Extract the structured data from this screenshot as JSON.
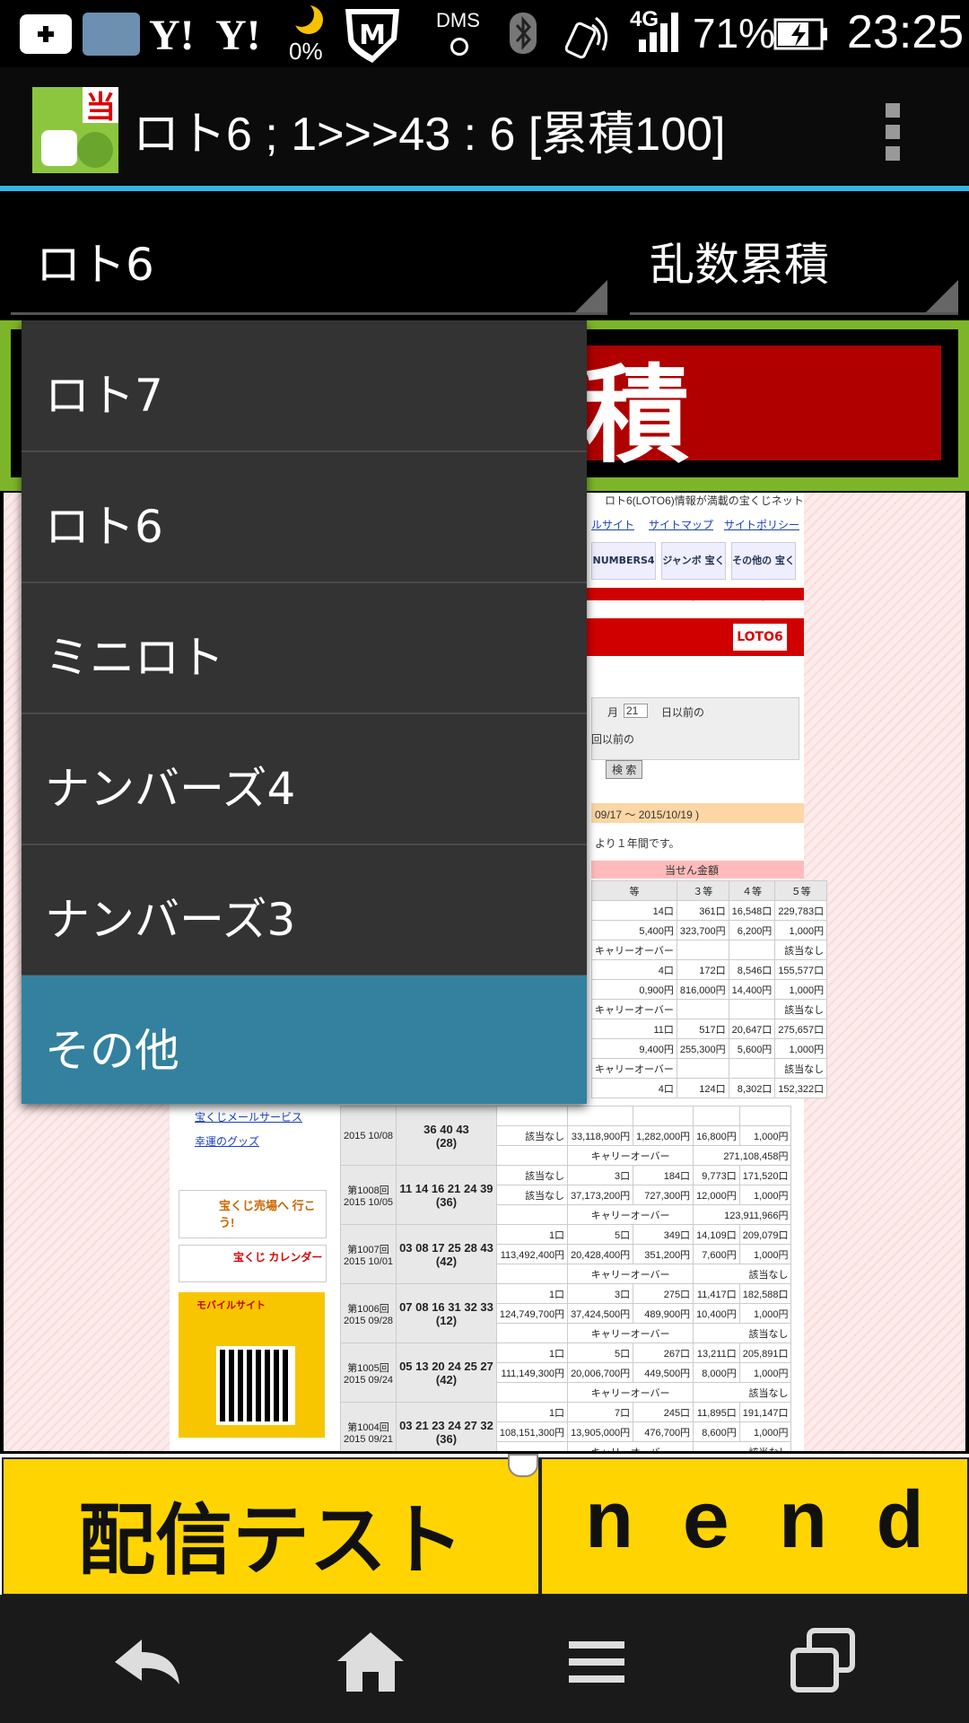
{
  "status_bar": {
    "left_badges": [
      "Y!",
      "Y!"
    ],
    "moon_percent": "0%",
    "dms": "DMS",
    "network": "4G",
    "battery": "71%",
    "time": "23:25"
  },
  "app_bar": {
    "title": "ロト6 ; 1>>>43 : 6 [累積100]"
  },
  "spinners": {
    "lottery_type": "ロト6",
    "mode": "乱数累積"
  },
  "banner": {
    "visible_char": "積"
  },
  "dropdown": {
    "items": [
      "ロト7",
      "ロト6",
      "ミニロト",
      "ナンバーズ4",
      "ナンバーズ3",
      "その他"
    ],
    "selected": "その他"
  },
  "web": {
    "header_text": "ロト6(LOTO6)情報が満載の宝くじネット",
    "links": [
      "ルサイト",
      "サイトマップ",
      "サイトポリシー"
    ],
    "logos": [
      "NUMBERS4",
      "ジャンボ 宝くじ",
      "その他の 宝くじ"
    ],
    "loto6_logo": "LOTO6",
    "search_month": "月",
    "search_day": "21",
    "search_suffix": "日以前の",
    "search_round_suffix": "回以前の",
    "search_button": "検 索",
    "period": "09/17 ～ 2015/10/19 )",
    "period_note": "より１年間です。",
    "prize_header": "当せん金額",
    "col_headers": [
      "等",
      "３等",
      "４等",
      "５等"
    ],
    "side_links": [
      "宝くじメールサービス",
      "幸運のグッズ"
    ],
    "side_ads": [
      "宝くじ売場へ 行こう!",
      "宝くじ カレンダー",
      "モバイルサイト"
    ],
    "carryover_label": "キャリーオーバー",
    "none_label": "該当なし",
    "top_rows": [
      [
        "14口",
        "361口",
        "16,548口",
        "229,783口"
      ],
      [
        "5,400円",
        "323,700円",
        "6,200円",
        "1,000円"
      ],
      [
        "4口",
        "172口",
        "8,546口",
        "155,577口"
      ],
      [
        "0,900円",
        "816,000円",
        "14,400円",
        "1,000円"
      ],
      [
        "11口",
        "517口",
        "20,647口",
        "275,657口"
      ],
      [
        "9,400円",
        "255,300円",
        "5,600円",
        "1,000円"
      ],
      [
        "4口",
        "124口",
        "8,302口",
        "152,322口"
      ]
    ],
    "draws": [
      {
        "round": "",
        "date": "2015 10/08",
        "nums": "36 40 43",
        "bonus": "(28)",
        "r1": [
          "該当なし",
          "33,118,900円",
          "1,282,000円",
          "16,800円",
          "1,000円"
        ],
        "co": "271,108,458円"
      },
      {
        "round": "第1008回",
        "date": "2015 10/05",
        "nums": "11 14 16 21 24 39",
        "bonus": "(36)",
        "r0": [
          "該当なし",
          "3口",
          "184口",
          "9,773口",
          "171,520口"
        ],
        "r1": [
          "該当なし",
          "37,173,200円",
          "727,300円",
          "12,000円",
          "1,000円"
        ],
        "co": "123,911,966円"
      },
      {
        "round": "第1007回",
        "date": "2015 10/01",
        "nums": "03 08 17 25 28 43",
        "bonus": "(42)",
        "r0": [
          "1口",
          "5口",
          "349口",
          "14,109口",
          "209,079口"
        ],
        "r1": [
          "113,492,400円",
          "20,428,400円",
          "351,200円",
          "7,600円",
          "1,000円"
        ],
        "co": "該当なし"
      },
      {
        "round": "第1006回",
        "date": "2015 09/28",
        "nums": "07 08 16 31 32 33",
        "bonus": "(12)",
        "r0": [
          "1口",
          "3口",
          "275口",
          "11,417口",
          "182,588口"
        ],
        "r1": [
          "124,749,700円",
          "37,424,500円",
          "489,900円",
          "10,400円",
          "1,000円"
        ],
        "co": "該当なし"
      },
      {
        "round": "第1005回",
        "date": "2015 09/24",
        "nums": "05 13 20 24 25 27",
        "bonus": "(42)",
        "r0": [
          "1口",
          "5口",
          "267口",
          "13,211口",
          "205,891口"
        ],
        "r1": [
          "111,149,300円",
          "20,006,700円",
          "449,500円",
          "8,000円",
          "1,000円"
        ],
        "co": "該当なし"
      },
      {
        "round": "第1004回",
        "date": "2015 09/21",
        "nums": "03 21 23 24 27 32",
        "bonus": "(36)",
        "r0": [
          "1口",
          "7口",
          "245口",
          "11,895口",
          "191,147口"
        ],
        "r1": [
          "108,151,300円",
          "13,905,000円",
          "476,700円",
          "8,600円",
          "1,000円"
        ],
        "co": "該当なし"
      }
    ]
  },
  "ads": {
    "left": "配信テスト",
    "right": "n e n d"
  },
  "colors": {
    "accent": "#33b5e5",
    "selected_item": "#33819f",
    "banner_green": "#7db52a",
    "banner_red": "#b00000",
    "ad_yellow": "#ffd400"
  }
}
